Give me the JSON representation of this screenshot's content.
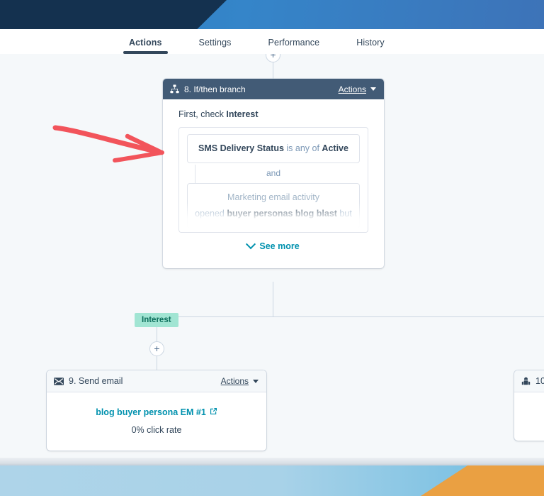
{
  "header": {
    "brand_navy": "#14314f",
    "brand_blue": "#3585c9"
  },
  "tabs": [
    {
      "label": "Actions",
      "active": true
    },
    {
      "label": "Settings",
      "active": false
    },
    {
      "label": "Performance",
      "active": false
    },
    {
      "label": "History",
      "active": false
    }
  ],
  "canvas": {
    "top_plus_label": "+",
    "branch_plus_label": "+"
  },
  "branch_card": {
    "icon": "branch-icon",
    "step_title": "8. If/then branch",
    "actions_label": "Actions",
    "check_prefix": "First, check ",
    "check_target": "Interest",
    "conditions": [
      {
        "meta": "",
        "subject": "SMS Delivery Status",
        "operator": " is any of ",
        "value": "Active"
      },
      {
        "meta": "Marketing email activity",
        "subject": "opened ",
        "operator": "buyer personas blog blast",
        "value": " but"
      }
    ],
    "join_label": "and",
    "see_more_label": "See more"
  },
  "branch_label": {
    "text": "Interest",
    "bg_color": "#a1e5d3",
    "text_color": "#0b6e5b"
  },
  "email_card": {
    "icon": "mail-icon",
    "step_title": "9. Send email",
    "actions_label": "Actions",
    "asset_name": "blog buyer persona EM #1",
    "external_icon": "external-link-icon",
    "stat": "0% click rate"
  },
  "list_card": {
    "icon": "list-icon",
    "step_title": "10"
  },
  "annotation": {
    "type": "red-arrow",
    "color": "#f2545b"
  },
  "bottom_band": {
    "blue": "#a8d2e8",
    "orange": "#eaa042"
  }
}
